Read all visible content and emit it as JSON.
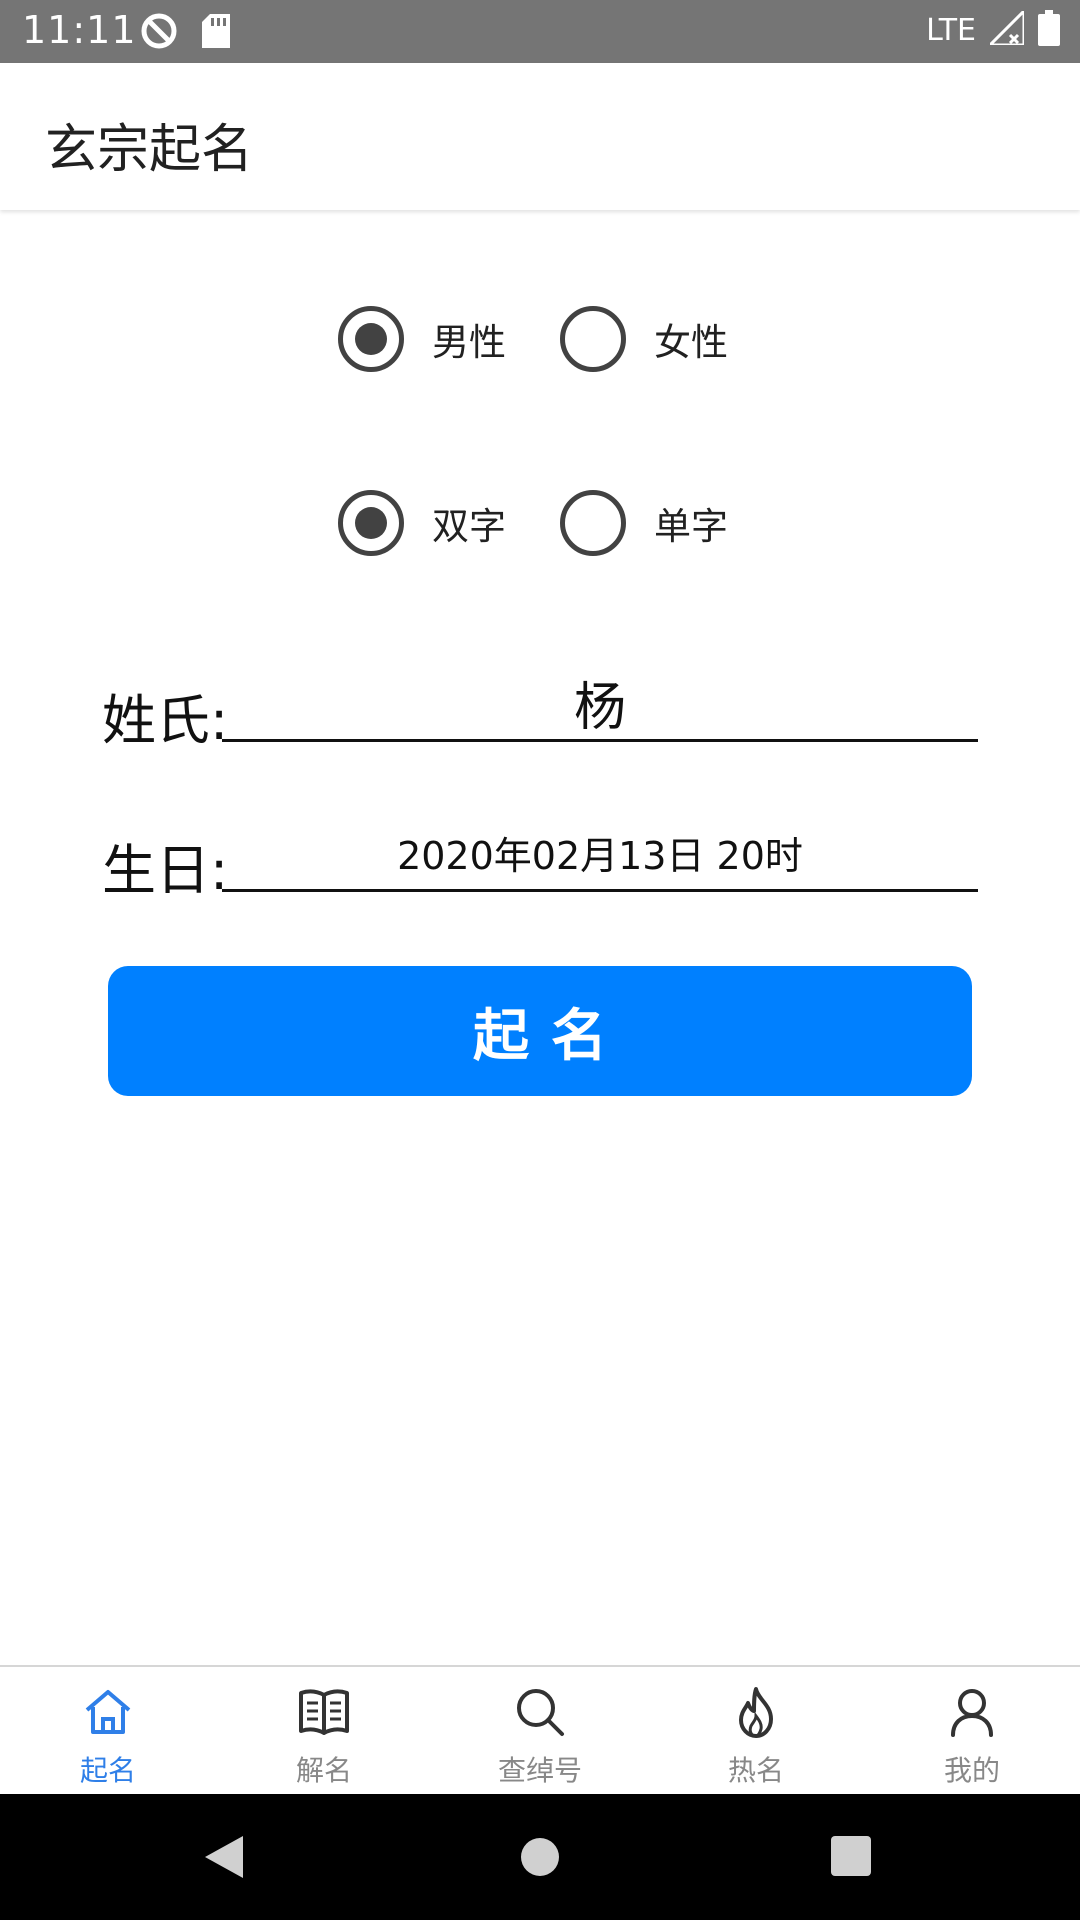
{
  "status_bar": {
    "time": "11:11",
    "network": "LTE",
    "icons": [
      "dnd-icon",
      "sd-card-icon",
      "signal-icon",
      "battery-icon"
    ]
  },
  "app_bar": {
    "title": "玄宗起名"
  },
  "gender": {
    "options": [
      {
        "label": "男性",
        "checked": true
      },
      {
        "label": "女性",
        "checked": false
      }
    ]
  },
  "name_length": {
    "options": [
      {
        "label": "双字",
        "checked": true
      },
      {
        "label": "单字",
        "checked": false
      }
    ]
  },
  "form": {
    "surname_label": "姓氏:",
    "surname_value": "杨",
    "birthday_label": "生日:",
    "birthday_value": "2020年02月13日 20时"
  },
  "actions": {
    "name_button": "起名"
  },
  "bottom_nav": {
    "items": [
      {
        "label": "起名",
        "icon": "home-icon",
        "active": true
      },
      {
        "label": "解名",
        "icon": "book-icon",
        "active": false
      },
      {
        "label": "查绰号",
        "icon": "search-icon",
        "active": false
      },
      {
        "label": "热名",
        "icon": "fire-icon",
        "active": false
      },
      {
        "label": "我的",
        "icon": "user-icon",
        "active": false
      }
    ]
  },
  "colors": {
    "accent": "#0080FF",
    "nav_active": "#2F7FE8",
    "status_bar": "#757575",
    "radio": "#424242"
  }
}
